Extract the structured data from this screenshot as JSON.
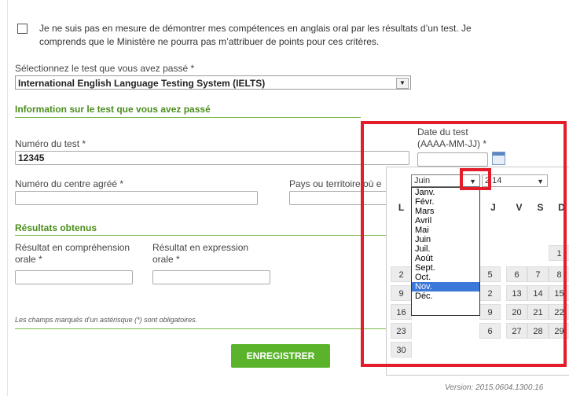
{
  "notice": {
    "line1": "Je ne suis pas en mesure de démontrer mes compétences en anglais oral par les résultats d’un test. Je",
    "line2": "comprends que le Ministère ne pourra pas m’attribuer de points pour ces critères."
  },
  "test_select": {
    "label": "Sélectionnez le test que vous avez passé",
    "value": "International English Language Testing System (IELTS)"
  },
  "section_info": {
    "title": "Information sur le test que vous avez passé"
  },
  "numero_test": {
    "label": "Numéro du test",
    "value": "12345"
  },
  "date_test": {
    "label_line1": "Date du test",
    "label_line2": "(AAAA-MM-JJ)"
  },
  "centre": {
    "label": "Numéro du centre agréé"
  },
  "pays": {
    "label": "Pays ou territoire où e"
  },
  "section_results": {
    "title": "Résultats obtenus"
  },
  "comprehension": {
    "label_line1": "Résultat en compréhension",
    "label_line2": "orale"
  },
  "expression": {
    "label_line1": "Résultat en expression",
    "label_line2": "orale"
  },
  "footnote": "Les champs marqués d’un astérisque (*) sont obligatoires.",
  "save_button": "ENREGISTRER",
  "version": "Version: 2015.0604.1300.16",
  "calendar": {
    "month_value": "Juin",
    "year_visible": "2  14",
    "weekdays": [
      "L",
      "",
      "",
      "V",
      "S",
      "D"
    ],
    "months": [
      "Janv.",
      "Févr.",
      "Mars",
      "Avril",
      "Mai",
      "Juin",
      "Juil.",
      "Août",
      "Sept.",
      "Oct.",
      "Nov.",
      "Déc."
    ],
    "selected_month_index": 10,
    "days_col_L": [
      "2",
      "9",
      "16",
      "23",
      "30"
    ],
    "days_row1": [
      "1"
    ],
    "days_grid": [
      [
        "6",
        "7",
        "8"
      ],
      [
        "13",
        "14",
        "15"
      ],
      [
        "20",
        "21",
        "22"
      ],
      [
        "27",
        "28",
        "29"
      ]
    ],
    "partial_digits": [
      "5",
      "2",
      "9",
      "6"
    ]
  }
}
